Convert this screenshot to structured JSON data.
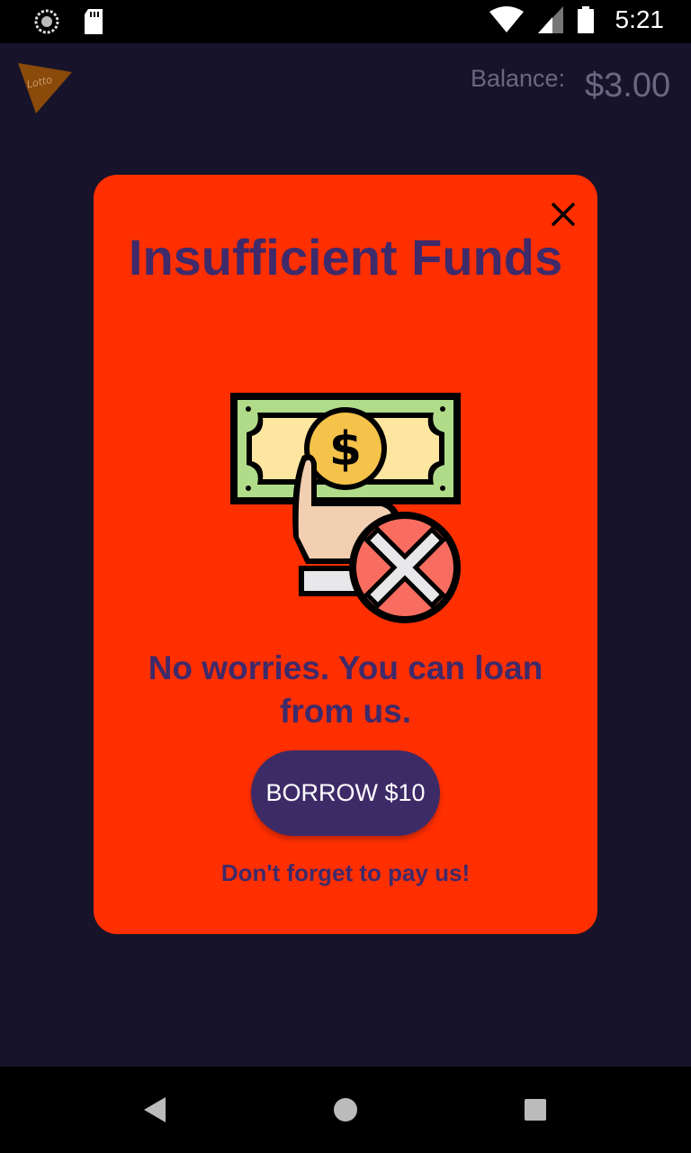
{
  "status_bar": {
    "time": "5:21",
    "icons": [
      "loading-icon",
      "sd-card-icon",
      "wifi-icon",
      "signal-icon",
      "battery-icon"
    ]
  },
  "app_bar": {
    "logo_text": "Lotto",
    "balance_label": "Balance:",
    "balance_value": "$3.00"
  },
  "dialog": {
    "title": "Insufficient Funds",
    "illustration": "no-money-icon",
    "message": "No worries. You can loan from us.",
    "borrow_button": "BORROW $10",
    "footnote": "Don't forget to pay us!",
    "close_icon": "close-icon"
  },
  "nav_bar": {
    "buttons": [
      "back-icon",
      "home-icon",
      "recents-icon"
    ]
  },
  "colors": {
    "background": "#17132a",
    "dialog": "#ff2f00",
    "text_accent": "#3f2a6a",
    "button": "#3d2b68"
  }
}
